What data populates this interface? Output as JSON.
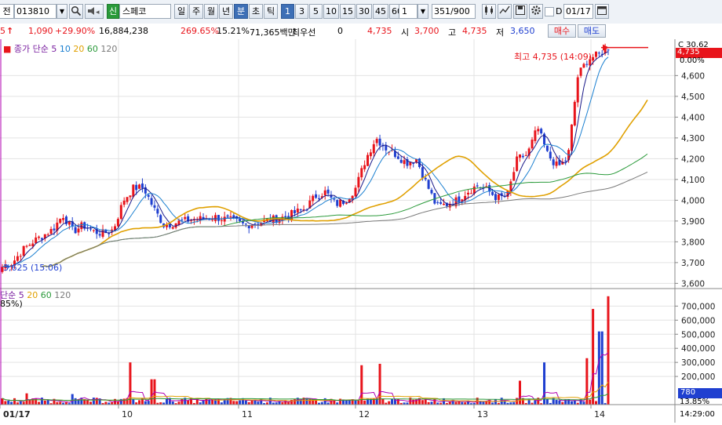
{
  "toolbar": {
    "tab_label": "전",
    "stock_code": "013810",
    "market_badge": "신",
    "stock_name": "스페코",
    "periods": [
      "일",
      "주",
      "월",
      "년",
      "분",
      "초",
      "틱"
    ],
    "active_period": "분",
    "intervals": [
      "1",
      "3",
      "5",
      "10",
      "15",
      "30",
      "45",
      "60"
    ],
    "active_interval": "1",
    "interval_select": "1",
    "count_value": "351",
    "count_max": "/900",
    "date_checkbox_label": "D",
    "date_value": "01/17"
  },
  "quote": {
    "change_prefix": "5",
    "change_arrow": "↑",
    "change": "1,090",
    "change_pct": "+29.90%",
    "volume": "16,884,238",
    "volume_ratio": "269.65%",
    "turnover": "15.21%",
    "amount": "71,365백만",
    "best_bid_label": "최우선",
    "best_bid_value": "0",
    "current": "4,735",
    "open_label": "시",
    "open": "3,700",
    "high_label": "고",
    "high": "4,735",
    "low_label": "저",
    "low": "3,650",
    "buy_label": "매수",
    "sell_label": "매도"
  },
  "colors": {
    "up": "#e8141b",
    "down": "#1f3fd0",
    "ma5": "#1a1a8a",
    "ma10": "#1a7fd0",
    "ma20": "#e0a000",
    "ma60": "#2a9a3a",
    "ma120": "#7a7a7a"
  },
  "price_legend": {
    "label": "종가 단순",
    "periods": [
      "5",
      "10",
      "20",
      "60",
      "120"
    ]
  },
  "volume_legend": {
    "label": "단순",
    "periods": [
      "5",
      "20",
      "60",
      "120"
    ],
    "left_fragment": "85%)"
  },
  "annotations": {
    "high": "최고 4,735 (14:09)",
    "low": "3,625 (15:06)",
    "price_right_pct": "C 30.62",
    "price_right_pct2": "0.00%",
    "last_price_tag": "4,735",
    "last_volume_tag": "780",
    "volume_right_pct": "13.85%",
    "time_label": "14:29:00"
  },
  "chart_data": {
    "type": "candlestick",
    "price_axis": {
      "ticks": [
        "4,600",
        "4,500",
        "4,400",
        "4,300",
        "4,200",
        "4,100",
        "4,000",
        "3,900",
        "3,800",
        "3,700",
        "3,600"
      ],
      "ylim": [
        3575,
        4775
      ]
    },
    "volume_axis": {
      "ticks": [
        "700,000",
        "600,000",
        "500,000",
        "400,000",
        "300,000",
        "200,000"
      ],
      "ylim": [
        0,
        780000
      ]
    },
    "x_ticks": [
      "01/17",
      "10",
      "11",
      "12",
      "13",
      "14"
    ],
    "price_path": [
      3680,
      3700,
      3760,
      3800,
      3830,
      3860,
      3930,
      3850,
      3880,
      3850,
      3840,
      3860,
      4000,
      4060,
      4060,
      3960,
      3880,
      3890,
      3900,
      3910,
      3910,
      3920,
      3910,
      3900,
      3880,
      3890,
      3900,
      3910,
      3920,
      3940,
      3960,
      4020,
      4040,
      3980,
      4000,
      4060,
      4200,
      4300,
      4250,
      4220,
      4180,
      4200,
      4080,
      3970,
      3980,
      4000,
      4040,
      4070,
      4050,
      4010,
      4020,
      4200,
      4220,
      4350,
      4220,
      4160,
      4200,
      4600,
      4680,
      4700,
      4735
    ],
    "volume_spikes": [
      [
        34,
        80000
      ],
      [
        93,
        75000
      ],
      [
        165,
        300000
      ],
      [
        195,
        180000
      ],
      [
        460,
        280000
      ],
      [
        483,
        290000
      ],
      [
        663,
        170000
      ],
      [
        693,
        300000
      ],
      [
        757,
        680000
      ],
      [
        765,
        520000
      ],
      [
        775,
        770000
      ],
      [
        748,
        330000
      ]
    ]
  }
}
